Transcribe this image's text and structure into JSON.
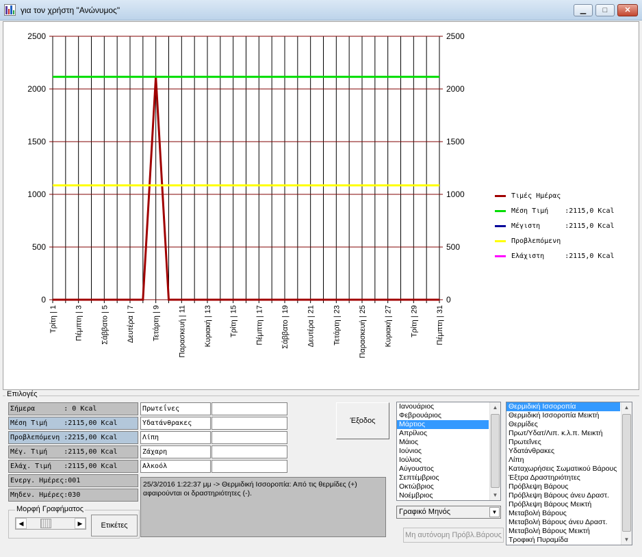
{
  "window": {
    "title": "για τον χρήστη \"Ανώνυμος\"",
    "min": "▁",
    "max": "□",
    "close": "✕"
  },
  "chart_data": {
    "type": "line",
    "title": "",
    "xlabel": "",
    "ylabel": "",
    "ylim": [
      0,
      2500
    ],
    "yticks": [
      0,
      500,
      1000,
      1500,
      2000,
      2500
    ],
    "grid": true,
    "x": [
      1,
      2,
      3,
      4,
      5,
      6,
      7,
      8,
      9,
      10,
      11,
      12,
      13,
      14,
      15,
      16,
      17,
      18,
      19,
      20,
      21,
      22,
      23,
      24,
      25,
      26,
      27,
      28,
      29,
      30,
      31
    ],
    "tick_labels": [
      "Τρίτη | 1",
      "Πέμπτη | 3",
      "Σάββατο | 5",
      "Δευτέρα | 7",
      "Τετάρτη | 9",
      "Παρασκευή | 11",
      "Κυριακή | 13",
      "Τρίτη | 15",
      "Πέμπτη | 17",
      "Σάββατο | 19",
      "Δευτέρα | 21",
      "Τετάρτη | 23",
      "Παρασκευή | 25",
      "Κυριακή | 27",
      "Τρίτη | 29",
      "Πέμπτη | 31"
    ],
    "legend_position": "right",
    "series": [
      {
        "name": "Τιμές Ημέρας",
        "color": "#a00000",
        "values": [
          0,
          0,
          0,
          0,
          0,
          0,
          0,
          0,
          2115,
          0,
          0,
          0,
          0,
          0,
          0,
          0,
          0,
          0,
          0,
          0,
          0,
          0,
          0,
          0,
          0,
          0,
          0,
          0,
          0,
          0,
          0
        ]
      },
      {
        "name": "Μέση Τιμή",
        "color": "#00dd00",
        "values": [
          2115,
          2115,
          2115,
          2115,
          2115,
          2115,
          2115,
          2115,
          2115,
          2115,
          2115,
          2115,
          2115,
          2115,
          2115,
          2115,
          2115,
          2115,
          2115,
          2115,
          2115,
          2115,
          2115,
          2115,
          2115,
          2115,
          2115,
          2115,
          2115,
          2115,
          2115
        ]
      },
      {
        "name": "Μέγιστη",
        "color": "#000099",
        "values": []
      },
      {
        "name": "Προβλεπόμενη",
        "color": "#ffff00",
        "values": [
          1085,
          1085,
          1085,
          1085,
          1085,
          1085,
          1085,
          1085,
          1085,
          1085,
          1085,
          1085,
          1085,
          1085,
          1085,
          1085,
          1085,
          1085,
          1085,
          1085,
          1085,
          1085,
          1085,
          1085,
          1085,
          1085,
          1085,
          1085,
          1085,
          1085,
          1085
        ]
      },
      {
        "name": "Ελάχιστη",
        "color": "#ff00ff",
        "values": []
      }
    ]
  },
  "legend": [
    {
      "text": "Τιμές Ημέρας",
      "color": "#a00000"
    },
    {
      "text": "Μέση Τιμή    :2115,0 Kcal",
      "color": "#00dd00"
    },
    {
      "text": "Μέγιστη      :2115,0 Kcal",
      "color": "#000099"
    },
    {
      "text": "Προβλεπόμενη",
      "color": "#ffff00"
    },
    {
      "text": "Ελάχιστη     :2115,0 Kcal",
      "color": "#ff00ff"
    }
  ],
  "options": {
    "group_label": "Επιλογές",
    "stats": [
      {
        "text": "Σήμερα       : 0 Kcal",
        "highlight": false
      },
      {
        "text": "Μέση Τιμή    :2115,00 Kcal",
        "highlight": true
      },
      {
        "text": "Προβλεπόμενη :2215,00 Kcal",
        "highlight": true
      },
      {
        "text": "Μέγ. Τιμή    :2115,00 Kcal",
        "highlight": false
      },
      {
        "text": "Ελάχ. Τιμή   :2115,00 Kcal",
        "highlight": false
      },
      {
        "text": "Ενεργ. Ημέρες:001",
        "highlight": false
      },
      {
        "text": "Μηδεν. Ημέρες:030",
        "highlight": false
      }
    ],
    "nutrients": [
      "Πρωτεΐνες",
      "Υδατάνθρακες",
      "Λίπη",
      "Ζάχαρη",
      "Αλκοόλ"
    ],
    "exit_label": "Έξοδος",
    "log_text": "25/3/2016 1:22:37 μμ -> Θερμιδική Ισσοροπία: Από τις θερμίδες (+) αφαιρούνται οι δραστηριότητες (-).",
    "graph_style_label": "Μορφή Γραφήματος",
    "labels_button": "Ετικέτες",
    "months": [
      "Ιανουάριος",
      "Φεβρουάριος",
      "Μάρτιος",
      "Απρίλιος",
      "Μάιος",
      "Ιούνιος",
      "Ιούλιος",
      "Αύγουστος",
      "Σεπτέμβριος",
      "Οκτώβριος",
      "Νοέμβριος"
    ],
    "selected_month": "Μάρτιος",
    "chart_period": "Γραφικό Μηνός",
    "predict_button": "Μη αυτόνομη Πρόβλ.Βάρους",
    "reports": [
      "Θερμιδική Ισσοροπία",
      "Θερμιδική Ισσοροπία Μεικτή",
      "Θερμίδες",
      "Πρωτ/Υδατ/Λιπ. κ.λ.π. Μεικτή",
      "Πρωτεΐνες",
      "Υδατάνθρακες",
      "Λίπη",
      "Καταχωρήσεις Σωματικού Βάρους",
      "Έξτρα Δραστηριότητες",
      "Πρόβλεψη Βάρους",
      "Πρόβλεψη Βάρους άνευ Δραστ.",
      "Πρόβλεψη Βάρους Μεικτή",
      "Μεταβολή Βάρους",
      "Μεταβολή Βάρους άνευ Δραστ.",
      "Μεταβολή Βάρους Μεικτή",
      "Τροφική Πυραμίδα"
    ],
    "selected_report": "Θερμιδική Ισσοροπία"
  }
}
